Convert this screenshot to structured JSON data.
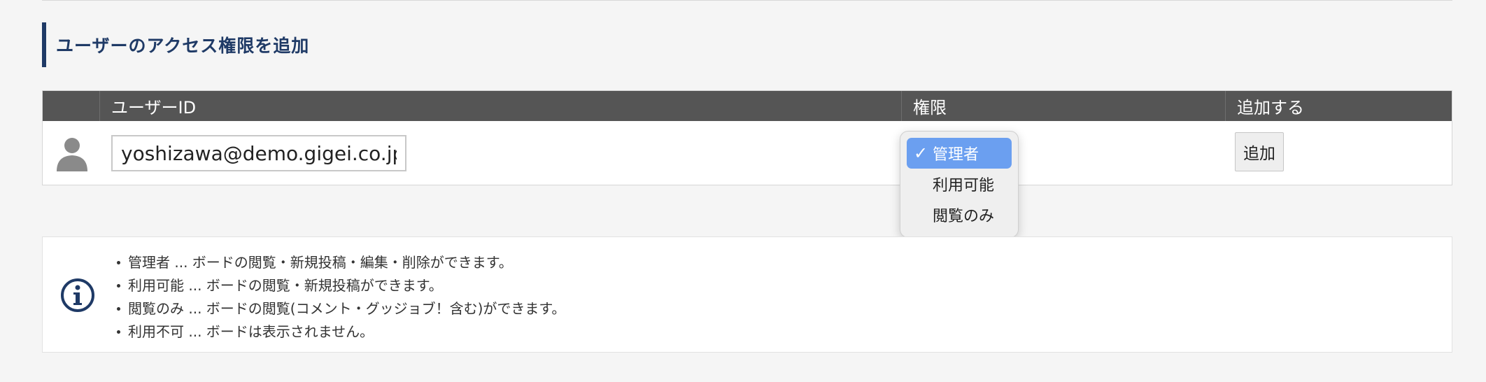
{
  "section": {
    "title": "ユーザーのアクセス権限を追加"
  },
  "table": {
    "headers": {
      "blank": "",
      "user_id": "ユーザーID",
      "permission": "権限",
      "add": "追加する"
    },
    "row": {
      "user_id_value": "yoshizawa@demo.gigei.co.jp",
      "add_button_label": "追加"
    }
  },
  "permission_dropdown": {
    "selected": "管理者",
    "options": [
      "管理者",
      "利用可能",
      "閲覧のみ"
    ],
    "check_glyph": "✓"
  },
  "info": {
    "items": [
      "管理者 ... ボードの閲覧・新規投稿・編集・削除ができます。",
      "利用可能 ... ボードの閲覧・新規投稿ができます。",
      "閲覧のみ ... ボードの閲覧(コメント・グッジョブ！含む)ができます。",
      "利用不可 ... ボードは表示されません。"
    ]
  },
  "colors": {
    "accent": "#1f3a66",
    "header_bg": "#555555",
    "selected_option": "#6b9ff0",
    "avatar": "#8a8a8a"
  },
  "icons": {
    "avatar": "user-silhouette-icon",
    "info": "info-circle-icon",
    "check": "check-icon"
  }
}
